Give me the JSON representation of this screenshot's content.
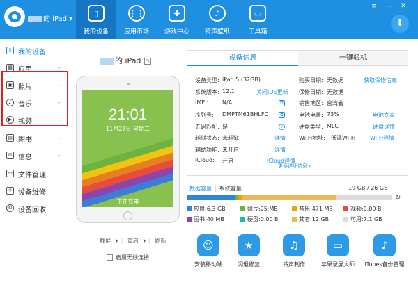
{
  "header": {
    "device_name": "的 iPad",
    "dropdown_caret": "▾",
    "nav": [
      {
        "label": "我的设备",
        "icon": "tablet-icon",
        "glyph": "▯"
      },
      {
        "label": "应用市场",
        "icon": "apps-grid-icon",
        "glyph": "⋮⋮"
      },
      {
        "label": "游戏中心",
        "icon": "gamepad-icon",
        "glyph": "✚"
      },
      {
        "label": "铃声壁纸",
        "icon": "bell-icon",
        "glyph": "♪"
      },
      {
        "label": "工具箱",
        "icon": "toolbox-icon",
        "glyph": "▭"
      }
    ],
    "window_controls": {
      "menu": "≡",
      "minimize": "—",
      "close": "✕"
    },
    "download_glyph": "⬇"
  },
  "sidebar": {
    "items": [
      {
        "label": "我的设备",
        "icon": "phone-icon",
        "glyph": "▯",
        "active": true
      },
      {
        "label": "应用",
        "icon": "apps-icon",
        "glyph": "▦"
      },
      {
        "label": "照片",
        "icon": "photo-icon",
        "glyph": "▣"
      },
      {
        "label": "音乐",
        "icon": "music-icon",
        "glyph": "♪"
      },
      {
        "label": "视频",
        "icon": "video-icon",
        "glyph": "▶"
      },
      {
        "label": "图书",
        "icon": "book-icon",
        "glyph": "▤"
      },
      {
        "label": "信息",
        "icon": "message-icon",
        "glyph": "✉"
      },
      {
        "label": "文件管理",
        "icon": "folder-icon",
        "glyph": "▭"
      },
      {
        "label": "设备维修",
        "icon": "repair-icon",
        "glyph": "✚"
      },
      {
        "label": "设备回收",
        "icon": "recycle-icon",
        "glyph": "↻"
      }
    ],
    "chevron": "⌄"
  },
  "device": {
    "title": "的 iPad",
    "screen_time": "21:01",
    "screen_date": "11月27日 星期二",
    "screen_status": "正在充电",
    "actions": [
      "截屏",
      "重启",
      "刷新"
    ],
    "wireless_label": "启用无线连接"
  },
  "info": {
    "tabs": [
      "设备信息",
      "一键验机"
    ],
    "left": [
      {
        "k": "设备类型:",
        "v": "iPad 5   (32GB)"
      },
      {
        "k": "系统版本:",
        "v": "12.1",
        "link": "关闭iOS更新"
      },
      {
        "k": "IMEI:",
        "v": "N/A",
        "icon": "copy-icon"
      },
      {
        "k": "序列号:",
        "v": "DMPTM61BHLFC",
        "icon": "copy-icon"
      },
      {
        "k": "五码匹配:",
        "v": "是",
        "icon": "help-icon"
      },
      {
        "k": "越狱状态:",
        "v": "未越狱",
        "link": "详情"
      },
      {
        "k": "辅助功能:",
        "v": "未开启",
        "link": "详情"
      },
      {
        "k": "iCloud:",
        "v": "开启",
        "link": "iCloud详情"
      }
    ],
    "right": [
      {
        "k": "购买日期:",
        "v": "无数据",
        "link": "获取保修信息"
      },
      {
        "k": "保修日期:",
        "v": "无数据"
      },
      {
        "k": "销售地区:",
        "v": "台湾省"
      },
      {
        "k": "电池电量:",
        "v": "73%",
        "link": "电池专家"
      },
      {
        "k": "硬盘类型:",
        "v": "MLC",
        "link": "硬盘详情"
      },
      {
        "k": "Wi-Fi地址:",
        "v": "低温Wi-Fi",
        "link": "Wi-Fi详情"
      }
    ],
    "more_link": "更多详细信息 »"
  },
  "storage": {
    "tab_data": "数据容量",
    "tab_system": "系统容量",
    "total": "19 GB / 26 GB",
    "segments": [
      {
        "name": "应用",
        "value": "6.3 GB",
        "color": "#2f86d3",
        "gb": 6.3
      },
      {
        "name": "照片",
        "value": "25 MB",
        "color": "#5db844",
        "gb": 0.3
      },
      {
        "name": "音乐",
        "value": "471 MB",
        "color": "#f39c12",
        "gb": 0.5
      },
      {
        "name": "视频",
        "value": "0.00 B",
        "color": "#e74c3c",
        "gb": 0
      },
      {
        "name": "图书",
        "value": "40 MB",
        "color": "#8e44ad",
        "gb": 0.1
      },
      {
        "name": "硬盘",
        "value": "0.00 B",
        "color": "#1abc9c",
        "gb": 0
      },
      {
        "name": "其它",
        "value": "12 GB",
        "color": "#e8b95a",
        "gb": 12
      },
      {
        "name": "可用",
        "value": "7.1 GB",
        "color": "#dcdcdc",
        "gb": 7.1
      }
    ],
    "refresh_glyph": "↻"
  },
  "tools": [
    {
      "label": "安装移动端",
      "icon": "install-mobile-icon",
      "glyph": "☺"
    },
    {
      "label": "闪退修复",
      "icon": "crash-repair-icon",
      "glyph": "★"
    },
    {
      "label": "铃声制作",
      "icon": "ringtone-icon",
      "glyph": "♫"
    },
    {
      "label": "苹果录屏大师",
      "icon": "screen-record-icon",
      "glyph": "▭"
    },
    {
      "label": "iTunes备份管理",
      "icon": "itunes-backup-icon",
      "glyph": "♪"
    }
  ],
  "colors": {
    "accent": "#1e8fe1",
    "header": "#1e8fe1",
    "highlight_box": "#e02020",
    "ipad_screen": "#88c14e"
  }
}
